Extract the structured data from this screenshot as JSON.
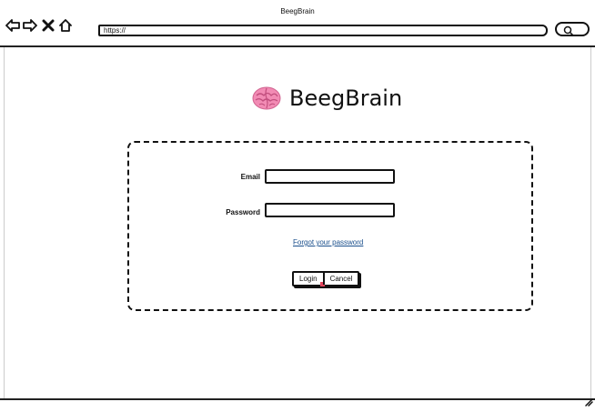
{
  "window": {
    "title": "BeegBrain"
  },
  "toolbar": {
    "back_icon": "back-arrow-icon",
    "forward_icon": "forward-arrow-icon",
    "stop_icon": "close-x-icon",
    "home_icon": "home-icon",
    "url": "https://",
    "search_icon": "search-icon"
  },
  "logo": {
    "text": "BeegBrain",
    "icon": "brain-icon",
    "icon_color": "#f28bb4"
  },
  "login_form": {
    "email_label": "Email",
    "email_value": "",
    "password_label": "Password",
    "password_value": "",
    "forgot_link": "Forgot your password",
    "login_button": "Login",
    "cancel_button": "Cancel"
  },
  "colors": {
    "link": "#1a4f8c",
    "cursor_marker": "#e2445c"
  }
}
